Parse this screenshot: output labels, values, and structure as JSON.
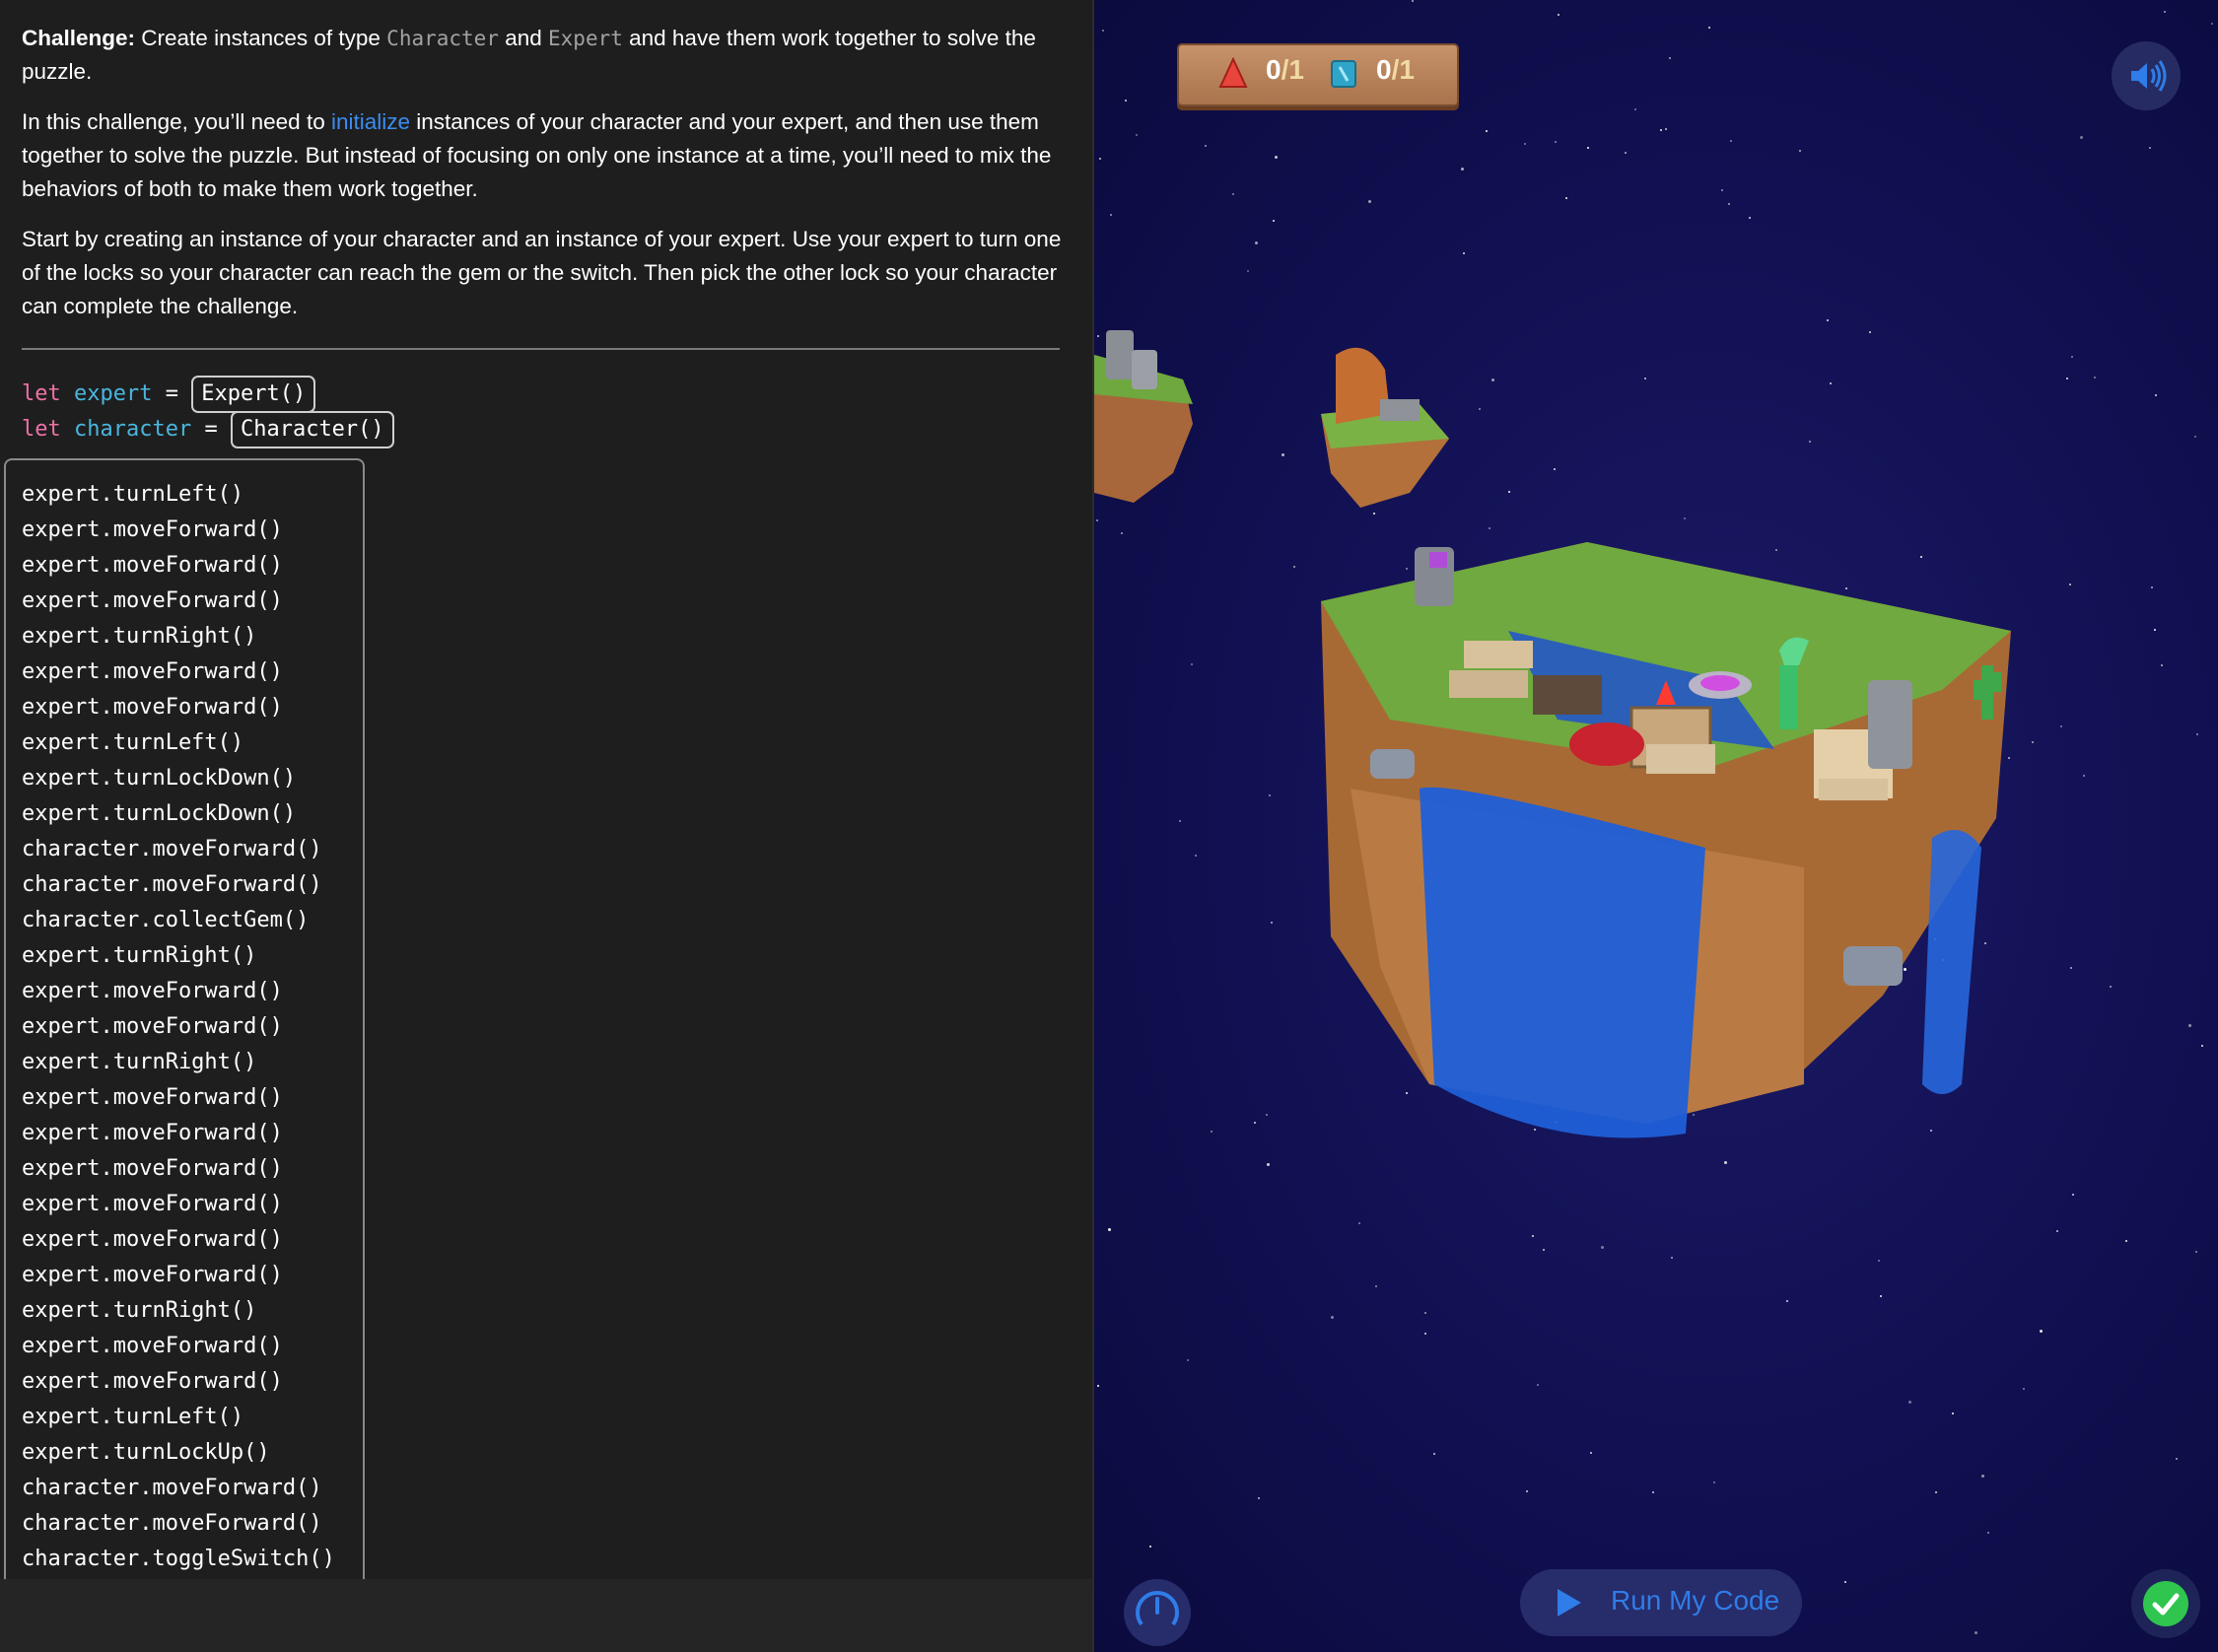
{
  "instructions": {
    "p1_bold": "Challenge:",
    "p1_a": " Create instances of type ",
    "p1_code1": "Character",
    "p1_b": " and ",
    "p1_code2": "Expert",
    "p1_c": " and have them work together to solve the puzzle.",
    "p2_a": "In this challenge, you’ll need to ",
    "p2_link": "initialize",
    "p2_b": " instances of your character and your expert, and then use them together to solve the puzzle. But instead of focusing on only one instance at a time, you’ll need to mix the behaviors of both to make them work together.",
    "p3": "Start by creating an instance of your character and an instance of your expert. Use your expert to turn one of the locks so your character can reach the gem or the switch. Then pick the other lock so your character can complete the challenge."
  },
  "declarations": {
    "kw": "let",
    "eq": "=",
    "expert_var": "expert",
    "expert_init": "Expert()",
    "character_var": "character",
    "character_init": "Character()"
  },
  "code_lines": [
    "expert.turnLeft()",
    "expert.moveForward()",
    "expert.moveForward()",
    "expert.moveForward()",
    "expert.turnRight()",
    "expert.moveForward()",
    "expert.moveForward()",
    "expert.turnLeft()",
    "expert.turnLockDown()",
    "expert.turnLockDown()",
    "character.moveForward()",
    "character.moveForward()",
    "character.collectGem()",
    "expert.turnRight()",
    "expert.moveForward()",
    "expert.moveForward()",
    "expert.turnRight()",
    "expert.moveForward()",
    "expert.moveForward()",
    "expert.moveForward()",
    "expert.moveForward()",
    "expert.moveForward()",
    "expert.moveForward()",
    "expert.turnRight()",
    "expert.moveForward()",
    "expert.moveForward()",
    "expert.turnLeft()",
    "expert.turnLockUp()",
    "character.moveForward()",
    "character.moveForward()",
    "character.toggleSwitch()"
  ],
  "scene": {
    "gem_counter": {
      "value": "0",
      "sep": "/",
      "total": "1",
      "icon": "gem-icon"
    },
    "switch_counter": {
      "value": "0",
      "sep": "/",
      "total": "1",
      "icon": "switch-icon"
    },
    "sound_icon": "speaker-icon",
    "speed_icon": "speedometer-icon",
    "run_label": "Run My Code",
    "run_icon": "play-icon",
    "status_icon": "checkmark-icon"
  },
  "colors": {
    "keyword": "#ee71a5",
    "identifier": "#4ab6de",
    "link": "#3b8df2",
    "accent_blue": "#2f7de8",
    "success_green": "#2fc54f",
    "space_bg": "#111052"
  }
}
